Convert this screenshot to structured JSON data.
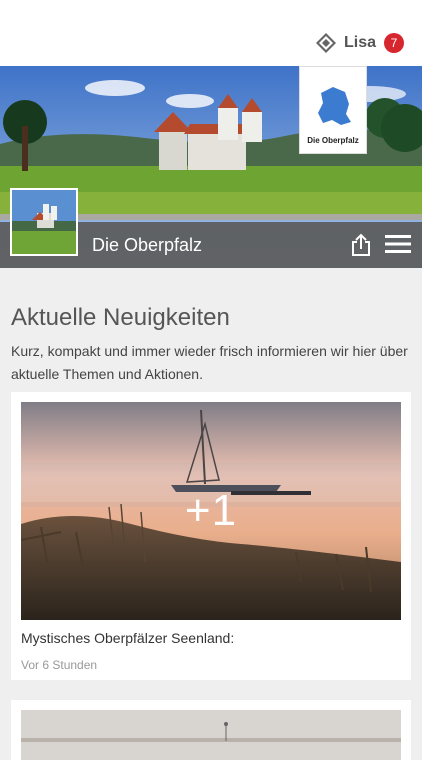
{
  "header": {
    "username": "Lisa",
    "notification_count": "7",
    "logo_icon": "diamond-logo-icon"
  },
  "hero": {
    "brand_label": "Die Oberpfalz",
    "title": "Die Oberpfalz"
  },
  "section": {
    "title": "Aktuelle Neuigkeiten",
    "intro": "Kurz, kompakt und immer wieder frisch informieren wir hier über aktuelle Themen und Aktionen."
  },
  "news": [
    {
      "extra_images": "+1",
      "title": "Mystisches Oberpfälzer Seenland:",
      "time": "Vor 6 Stunden"
    }
  ],
  "colors": {
    "badge": "#d8262f",
    "hero_bar": "#5a5a5a",
    "brand_blue": "#3b7bd0"
  }
}
